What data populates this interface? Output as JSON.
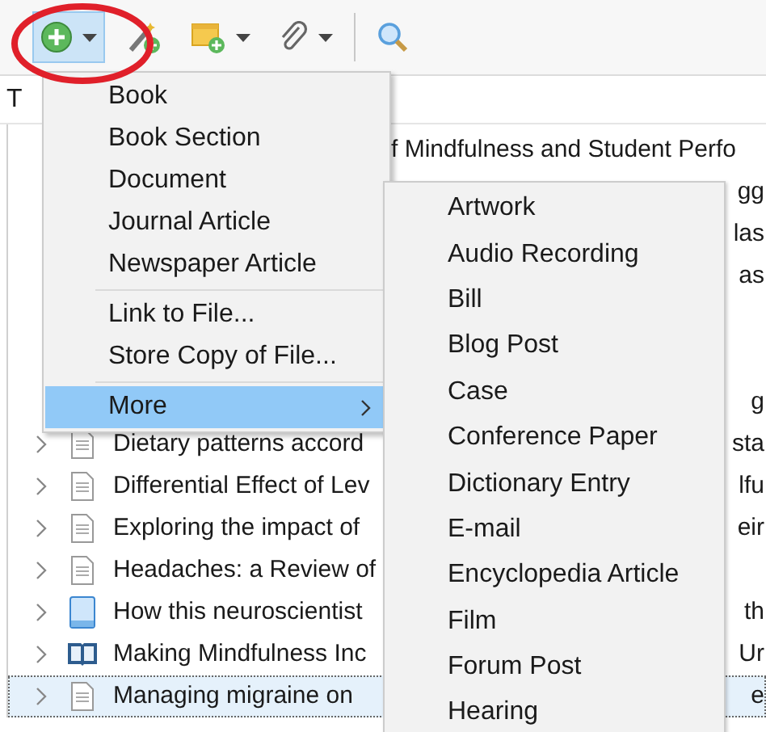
{
  "toolbar": {
    "buttons": [
      {
        "kind": "new_item",
        "pressed": true,
        "dropdown": true
      },
      {
        "kind": "add_by_identifier",
        "pressed": false,
        "dropdown": false
      },
      {
        "kind": "new_note",
        "pressed": false,
        "dropdown": true
      },
      {
        "kind": "attachment",
        "pressed": false,
        "dropdown": true
      },
      {
        "kind": "separator"
      },
      {
        "kind": "search",
        "pressed": false,
        "dropdown": false
      }
    ]
  },
  "annotation": {
    "kind": "circle",
    "color": "#e0202a"
  },
  "table": {
    "columns": [
      "T"
    ],
    "rows": [
      {
        "kind": "covered",
        "tail": "f Mindfulness and Student Perfo"
      },
      {
        "kind": "covered",
        "tail": "gg"
      },
      {
        "kind": "covered",
        "tail": "las"
      },
      {
        "kind": "covered",
        "tail": "as"
      },
      {
        "kind": "covered"
      },
      {
        "kind": "covered"
      },
      {
        "kind": "covered",
        "tail": "g"
      },
      {
        "kind": "document",
        "title": "Dietary patterns accord",
        "tail": "sta",
        "selected": false
      },
      {
        "kind": "document",
        "title": "Differential Effect of Lev",
        "tail": "lfu",
        "selected": false
      },
      {
        "kind": "document",
        "title": "Exploring the impact of",
        "tail": "eir",
        "selected": false
      },
      {
        "kind": "document",
        "title": "Headaches: a Review of",
        "selected": false
      },
      {
        "kind": "web_page",
        "title": "How this neuroscientist",
        "tail": "th",
        "selected": false
      },
      {
        "kind": "book",
        "title": "Making Mindfulness Inc",
        "tail": "Ur",
        "selected": false
      },
      {
        "kind": "document",
        "title": "Managing migraine on",
        "tail": "e",
        "selected": true
      }
    ]
  },
  "menu": {
    "items": [
      {
        "kind": "item",
        "label": "Book",
        "highlighted": false,
        "submenu": false
      },
      {
        "kind": "item",
        "label": "Book Section",
        "highlighted": false,
        "submenu": false
      },
      {
        "kind": "item",
        "label": "Document",
        "highlighted": false,
        "submenu": false
      },
      {
        "kind": "item",
        "label": "Journal Article",
        "highlighted": false,
        "submenu": false
      },
      {
        "kind": "item",
        "label": "Newspaper Article",
        "highlighted": false,
        "submenu": false
      },
      {
        "kind": "separator"
      },
      {
        "kind": "item",
        "label": "Link to File...",
        "highlighted": false,
        "submenu": false
      },
      {
        "kind": "item",
        "label": "Store Copy of File...",
        "highlighted": false,
        "submenu": false
      },
      {
        "kind": "separator"
      },
      {
        "kind": "item",
        "label": "More",
        "highlighted": true,
        "submenu": true
      }
    ]
  },
  "submenu": {
    "items": [
      "Artwork",
      "Audio Recording",
      "Bill",
      "Blog Post",
      "Case",
      "Conference Paper",
      "Dictionary Entry",
      "E-mail",
      "Encyclopedia Article",
      "Film",
      "Forum Post",
      "Hearing"
    ]
  }
}
